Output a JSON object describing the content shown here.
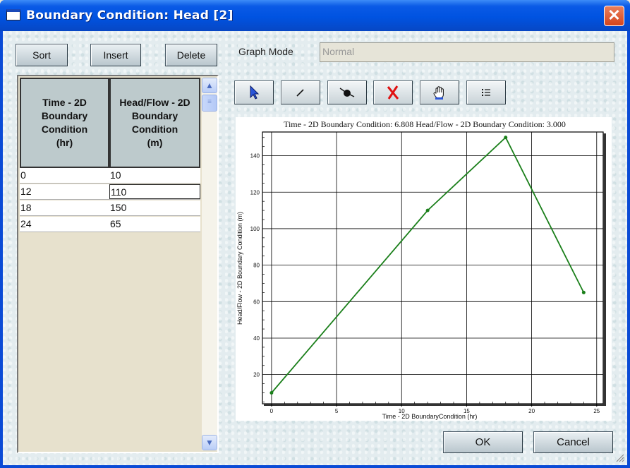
{
  "window": {
    "title": "Boundary Condition: Head [2]",
    "close_glyph": "✕",
    "icon": "window-icon"
  },
  "buttons": {
    "sort": "Sort",
    "insert": "Insert",
    "delete": "Delete",
    "ok": "OK",
    "cancel": "Cancel"
  },
  "graph_mode": {
    "label": "Graph Mode",
    "value": "Normal"
  },
  "table": {
    "columns": [
      "Time - 2D\nBoundary\nCondition\n(hr)",
      "Head/Flow - 2D\nBoundary\nCondition\n(m)"
    ],
    "rows": [
      [
        "0",
        "10"
      ],
      [
        "12",
        "110"
      ],
      [
        "18",
        "150"
      ],
      [
        "24",
        "65"
      ]
    ],
    "selected_cell": [
      1,
      1
    ]
  },
  "scrollbar": {
    "up_glyph": "▲",
    "down_glyph": "▼",
    "thumb_glyph": "≡"
  },
  "toolbar": [
    {
      "name": "select-tool",
      "icon": "cursor-arrow-icon"
    },
    {
      "name": "line-tool",
      "icon": "line-icon"
    },
    {
      "name": "point-tool",
      "icon": "point-icon"
    },
    {
      "name": "delete-point-tool",
      "icon": "delete-x-icon"
    },
    {
      "name": "pan-tool",
      "icon": "hand-icon"
    },
    {
      "name": "list-tool",
      "icon": "list-icon"
    }
  ],
  "chart_data": {
    "type": "line",
    "title": "Time - 2D Boundary Condition: 6.808 Head/Flow - 2D Boundary Condition: 3.000",
    "xlabel": "Time - 2D BoundaryCondition (hr)",
    "ylabel": "Head/Flow - 2D Boundary Condition (m)",
    "x": [
      0,
      12,
      18,
      24
    ],
    "series": [
      {
        "values": [
          10,
          110,
          150,
          65
        ]
      }
    ],
    "xlim": [
      -0.7,
      25.5
    ],
    "ylim": [
      4,
      153
    ],
    "xticks": [
      0,
      5,
      10,
      15,
      20,
      25
    ],
    "yticks": [
      20,
      40,
      60,
      80,
      100,
      120,
      140
    ],
    "grid": true,
    "line_color": "#1a7f1a"
  }
}
